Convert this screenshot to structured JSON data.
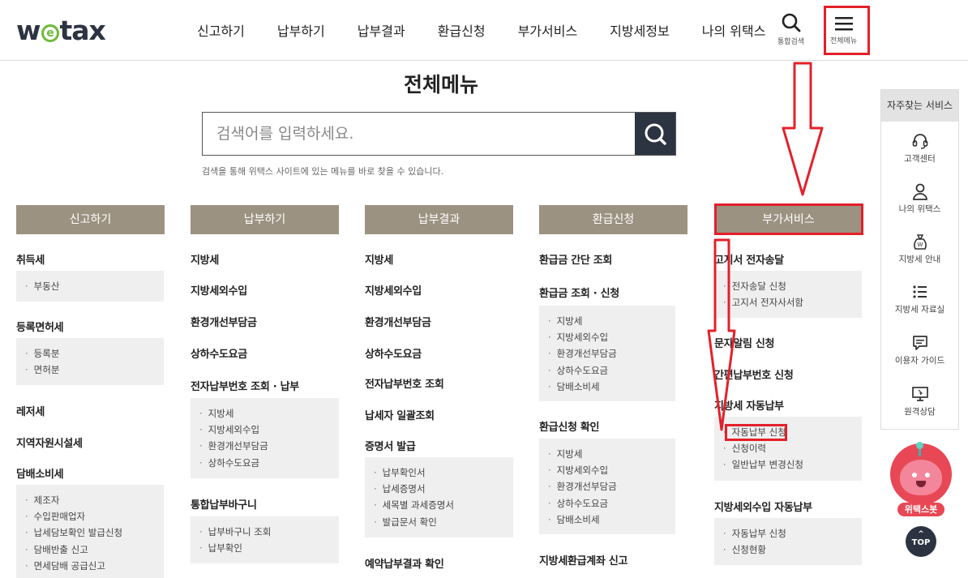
{
  "logo": {
    "pre": "w",
    "e": "e",
    "post": "tax"
  },
  "gnb": [
    "신고하기",
    "납부하기",
    "납부결과",
    "환급신청",
    "부가서비스",
    "지방세정보",
    "나의 위택스"
  ],
  "tools": {
    "search_label": "통합검색",
    "menu_label": "전체메뉴"
  },
  "page_title": "전체메뉴",
  "search": {
    "placeholder": "검색어를 입력하세요.",
    "description": "검색을 통해 위택스 사이트에 있는 메뉴를 바로 찾을 수 있습니다."
  },
  "columns": [
    {
      "head": "신고하기",
      "items": [
        "취득세",
        "등록면허세",
        "레저세",
        "지역자원시설세",
        "담배소비세"
      ],
      "subs": [
        [
          "부동산"
        ],
        [
          "등록분",
          "면허분"
        ],
        [
          "제조자",
          "수입판매업자",
          "납세담보확인 발급신청",
          "담배반출 신고",
          "면세담배 공급신고"
        ]
      ]
    },
    {
      "head": "납부하기",
      "items": [
        "지방세",
        "지방세외수입",
        "환경개선부담금",
        "상하수도요금",
        "전자납부번호 조회 · 납부",
        "통합납부바구니"
      ],
      "subs": [
        [
          "지방세",
          "지방세외수입",
          "환경개선부담금",
          "상하수도요금"
        ],
        [
          "납부바구니 조회",
          "납부확인"
        ]
      ]
    },
    {
      "head": "납부결과",
      "items": [
        "지방세",
        "지방세외수입",
        "환경개선부담금",
        "상하수도요금",
        "전자납부번호 조회",
        "납세자 일괄조회",
        "증명서 발급",
        "예약납부결과 확인"
      ],
      "subs": [
        [
          "납부확인서",
          "납세증명서",
          "세목별 과세증명서",
          "발급문서 확인"
        ]
      ]
    },
    {
      "head": "환급신청",
      "items": [
        "환급금 간단 조회",
        "환급금 조회 · 신청",
        "환급신청 확인",
        "지방세환급계좌 신고"
      ],
      "subs": [
        [
          "지방세",
          "지방세외수입",
          "환경개선부담금",
          "상하수도요금",
          "담배소비세"
        ],
        [
          "지방세",
          "지방세외수입",
          "환경개선부담금",
          "상하수도요금",
          "담배소비세"
        ]
      ]
    },
    {
      "head": "부가서비스",
      "items": [
        "고지서 전자송달",
        "문자알림 신청",
        "간편납부번호 신청",
        "지방세 자동납부",
        "지방세외수입 자동납부"
      ],
      "subs": [
        [
          "전자송달 신청",
          "고지서 전자사서함"
        ],
        [
          "자동납부 신청",
          "신청이력",
          "일반납부 변경신청"
        ],
        [
          "자동납부 신청",
          "신청현황"
        ]
      ]
    }
  ],
  "quick": {
    "title": "자주찾는 서비스",
    "items": [
      {
        "label": "고객센터",
        "icon": "headset-icon"
      },
      {
        "label": "나의 위택스",
        "icon": "person-icon"
      },
      {
        "label": "지방세 안내",
        "icon": "moneybag-icon"
      },
      {
        "label": "지방세 자료실",
        "icon": "list-icon"
      },
      {
        "label": "이용자 가이드",
        "icon": "chat-icon"
      },
      {
        "label": "원격상담",
        "icon": "monitor-icon"
      }
    ],
    "bot_label": "위택스봇",
    "top_label": "TOP"
  },
  "colors": {
    "brand_dark": "#2d3441",
    "brand_green": "#6dbb3a",
    "column_head": "#9c9281",
    "highlight_red": "#e3202a",
    "bot_red": "#e84855"
  }
}
